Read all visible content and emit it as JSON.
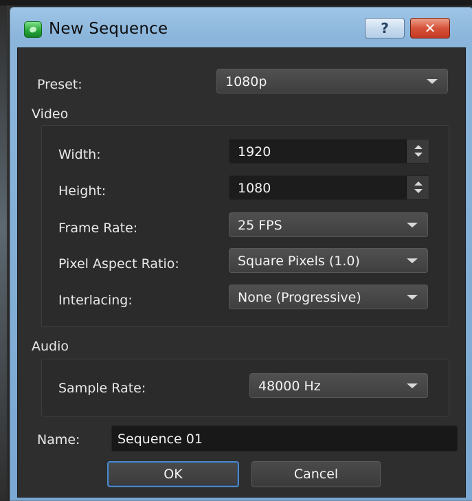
{
  "window": {
    "title": "New Sequence",
    "help_label": "?",
    "close_label": "✕"
  },
  "preset": {
    "label": "Preset:",
    "value": "1080p"
  },
  "video": {
    "section_label": "Video",
    "width_label": "Width:",
    "width_value": "1920",
    "height_label": "Height:",
    "height_value": "1080",
    "frame_rate_label": "Frame Rate:",
    "frame_rate_value": "25 FPS",
    "pixel_aspect_label": "Pixel Aspect Ratio:",
    "pixel_aspect_value": "Square Pixels (1.0)",
    "interlacing_label": "Interlacing:",
    "interlacing_value": "None (Progressive)"
  },
  "audio": {
    "section_label": "Audio",
    "sample_rate_label": "Sample Rate:",
    "sample_rate_value": "48000 Hz"
  },
  "name": {
    "label": "Name:",
    "value": "Sequence 01"
  },
  "buttons": {
    "ok": "OK",
    "cancel": "Cancel"
  },
  "colors": {
    "client_bg": "#2e2e2e",
    "titlebar_accent": "#8bb5db",
    "default_button_border": "#4f87c4",
    "close_button": "#c43a22"
  },
  "icons": {
    "app": "app-logo-icon",
    "help": "help-icon",
    "close": "close-icon",
    "dropdown": "chevron-down-icon",
    "spin": "spin-arrows-icon"
  }
}
